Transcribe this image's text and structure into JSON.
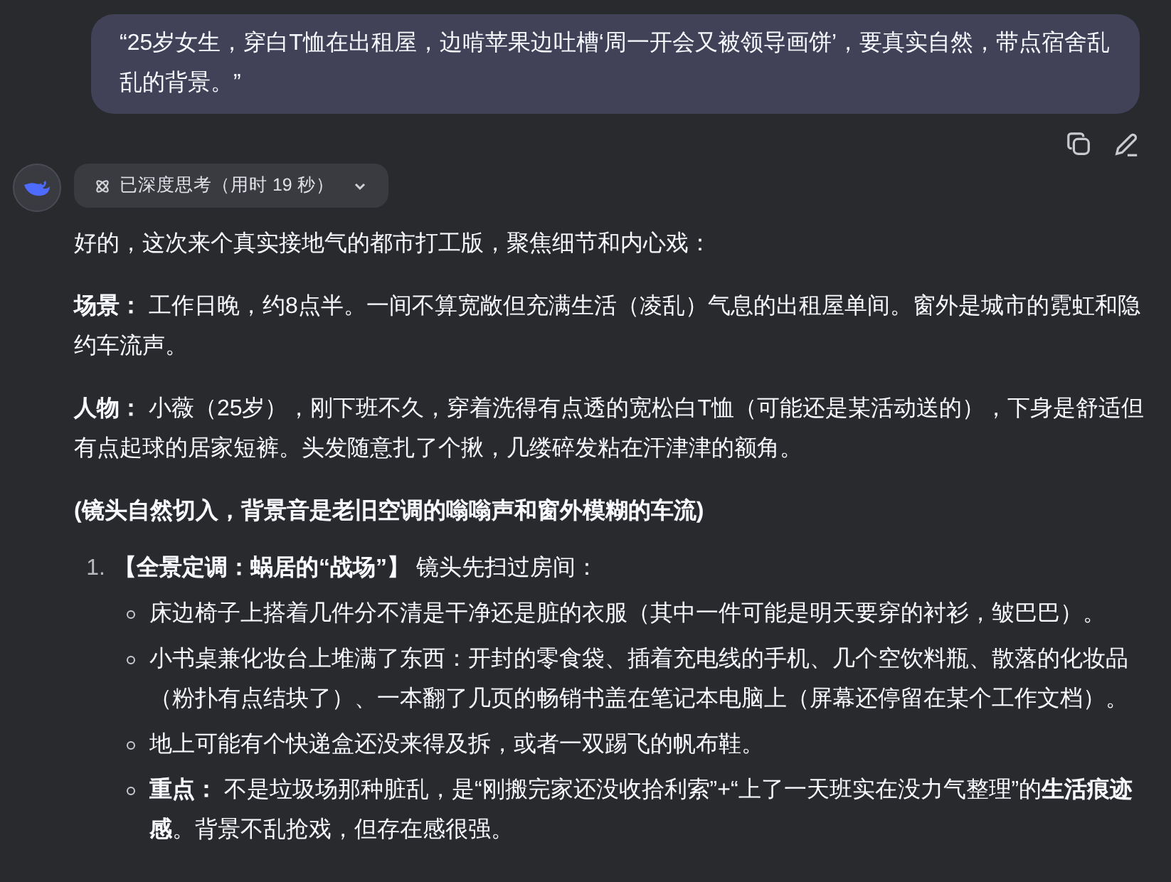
{
  "user_message": {
    "text": "“25岁女生，穿白T恤在出租屋，边啃苹果边吐槽‘周一开会又被领导画饼’，要真实自然，带点宿舍乱乱的背景。”"
  },
  "thinking": {
    "label": "已深度思考（用时 19 秒）",
    "expanded": false
  },
  "response": [
    {
      "kind": "paragraph",
      "text": "好的，这次来个真实接地气的都市打工版，聚焦细节和内心戏："
    },
    {
      "kind": "paragraph",
      "text": "**场景：** 工作日晚，约8点半。一间不算宽敞但充满生活（凌乱）气息的出租屋单间。窗外是城市的霓虹和隐约车流声。"
    },
    {
      "kind": "paragraph",
      "text": "**人物：** 小薇（25岁），刚下班不久，穿着洗得有点透的宽松白T恤（可能还是某活动送的），下身是舒适但有点起球的居家短裤。头发随意扎了个揪，几缕碎发粘在汗津津的额角。"
    },
    {
      "kind": "note",
      "text": "(镜头自然切入，背景音是老旧空调的嗡嗡声和窗外模糊的车流)"
    },
    {
      "kind": "list",
      "items": [
        {
          "number": "1.",
          "text": "**【全景定调：蜗居的“战场”】** 镜头先扫过房间：",
          "children": [
            {
              "text": "床边椅子上搭着几件分不清是干净还是脏的衣服（其中一件可能是明天要穿的衬衫，皱巴巴）。"
            },
            {
              "text": "小书桌兼化妆台上堆满了东西：开封的零食袋、插着充电线的手机、几个空饮料瓶、散落的化妆品（粉扑有点结块了）、一本翻了几页的畅销书盖在笔记本电脑上（屏幕还停留在某个工作文档）。"
            },
            {
              "text": "地上可能有个快递盒还没来得及拆，或者一双踢飞的帆布鞋。"
            },
            {
              "text": "**重点：** 不是垃圾场那种脏乱，是“刚搬完家还没收拾利索”+“上了一天班实在没力气整理”的**生活痕迹感**。背景不乱抢戏，但存在感很强。"
            }
          ]
        }
      ]
    }
  ]
}
